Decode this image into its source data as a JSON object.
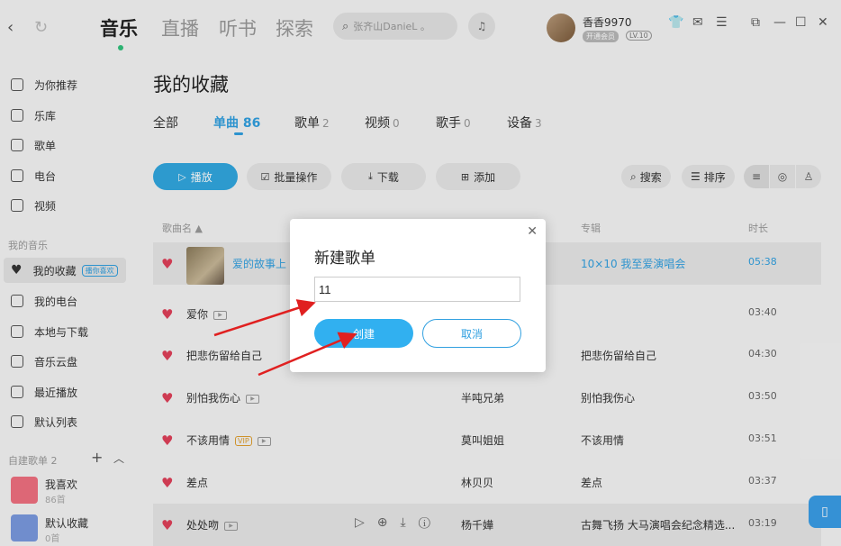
{
  "nav": {
    "back": "‹",
    "forward": "↻"
  },
  "main_tabs": [
    "音乐",
    "直播",
    "听书",
    "探索"
  ],
  "search": {
    "placeholder": "张齐山DanieL 。"
  },
  "user": {
    "name": "香香9970",
    "vip": "开通会员",
    "level": "LV.10"
  },
  "top_icons": [
    "shirt-icon",
    "mail-icon",
    "menu-icon",
    "mini-mode-icon",
    "minimize-icon",
    "maximize-icon",
    "close-icon"
  ],
  "sidebar": {
    "items": [
      "为你推荐",
      "乐库",
      "歌单",
      "电台",
      "视频"
    ],
    "my_music_label": "我的音乐",
    "my_items": [
      "我的收藏",
      "我的电台",
      "本地与下载",
      "音乐云盘",
      "最近播放",
      "默认列表"
    ],
    "play_tag": "播你喜欢",
    "created_label": "自建歌单 2",
    "playlists": [
      {
        "name": "我喜欢",
        "count": "86首"
      },
      {
        "name": "默认收藏",
        "count": "0首"
      }
    ]
  },
  "page": {
    "title": "我的收藏"
  },
  "subtabs": [
    {
      "label": "全部",
      "count": ""
    },
    {
      "label": "单曲",
      "count": "86"
    },
    {
      "label": "歌单",
      "count": "2"
    },
    {
      "label": "视频",
      "count": "0"
    },
    {
      "label": "歌手",
      "count": "0"
    },
    {
      "label": "设备",
      "count": "3"
    }
  ],
  "actions": {
    "play": "播放",
    "batch": "批量操作",
    "download": "下载",
    "add": "添加",
    "search": "搜索",
    "sort": "排序"
  },
  "columns": {
    "song": "歌曲名 ▲",
    "album": "专辑",
    "duration": "时长"
  },
  "songs": [
    {
      "title": "爱的故事上",
      "artist": "",
      "album": "10×10 我至爱演唱会",
      "duration": "05:38"
    },
    {
      "title": "爱你",
      "artist": "",
      "album": "",
      "duration": "03:40"
    },
    {
      "title": "把悲伤留给自己",
      "artist": "",
      "album": "把悲伤留给自己",
      "duration": "04:30"
    },
    {
      "title": "别怕我伤心",
      "artist": "半吨兄弟",
      "album": "别怕我伤心",
      "duration": "03:50"
    },
    {
      "title": "不该用情",
      "artist": "莫叫姐姐",
      "album": "不该用情",
      "duration": "03:51"
    },
    {
      "title": "差点",
      "artist": "林贝贝",
      "album": "差点",
      "duration": "03:37"
    },
    {
      "title": "处处吻",
      "artist": "杨千嬅",
      "album": "古舞飞扬 大马演唱会纪念精选...",
      "duration": "03:19"
    }
  ],
  "vip_tag": "VIP",
  "modal": {
    "title": "新建歌单",
    "input_value": "11",
    "create": "创建",
    "cancel": "取消"
  },
  "colors": {
    "accent": "#31a0e0",
    "heart": "#e0405a",
    "arrow": "#e02020"
  }
}
